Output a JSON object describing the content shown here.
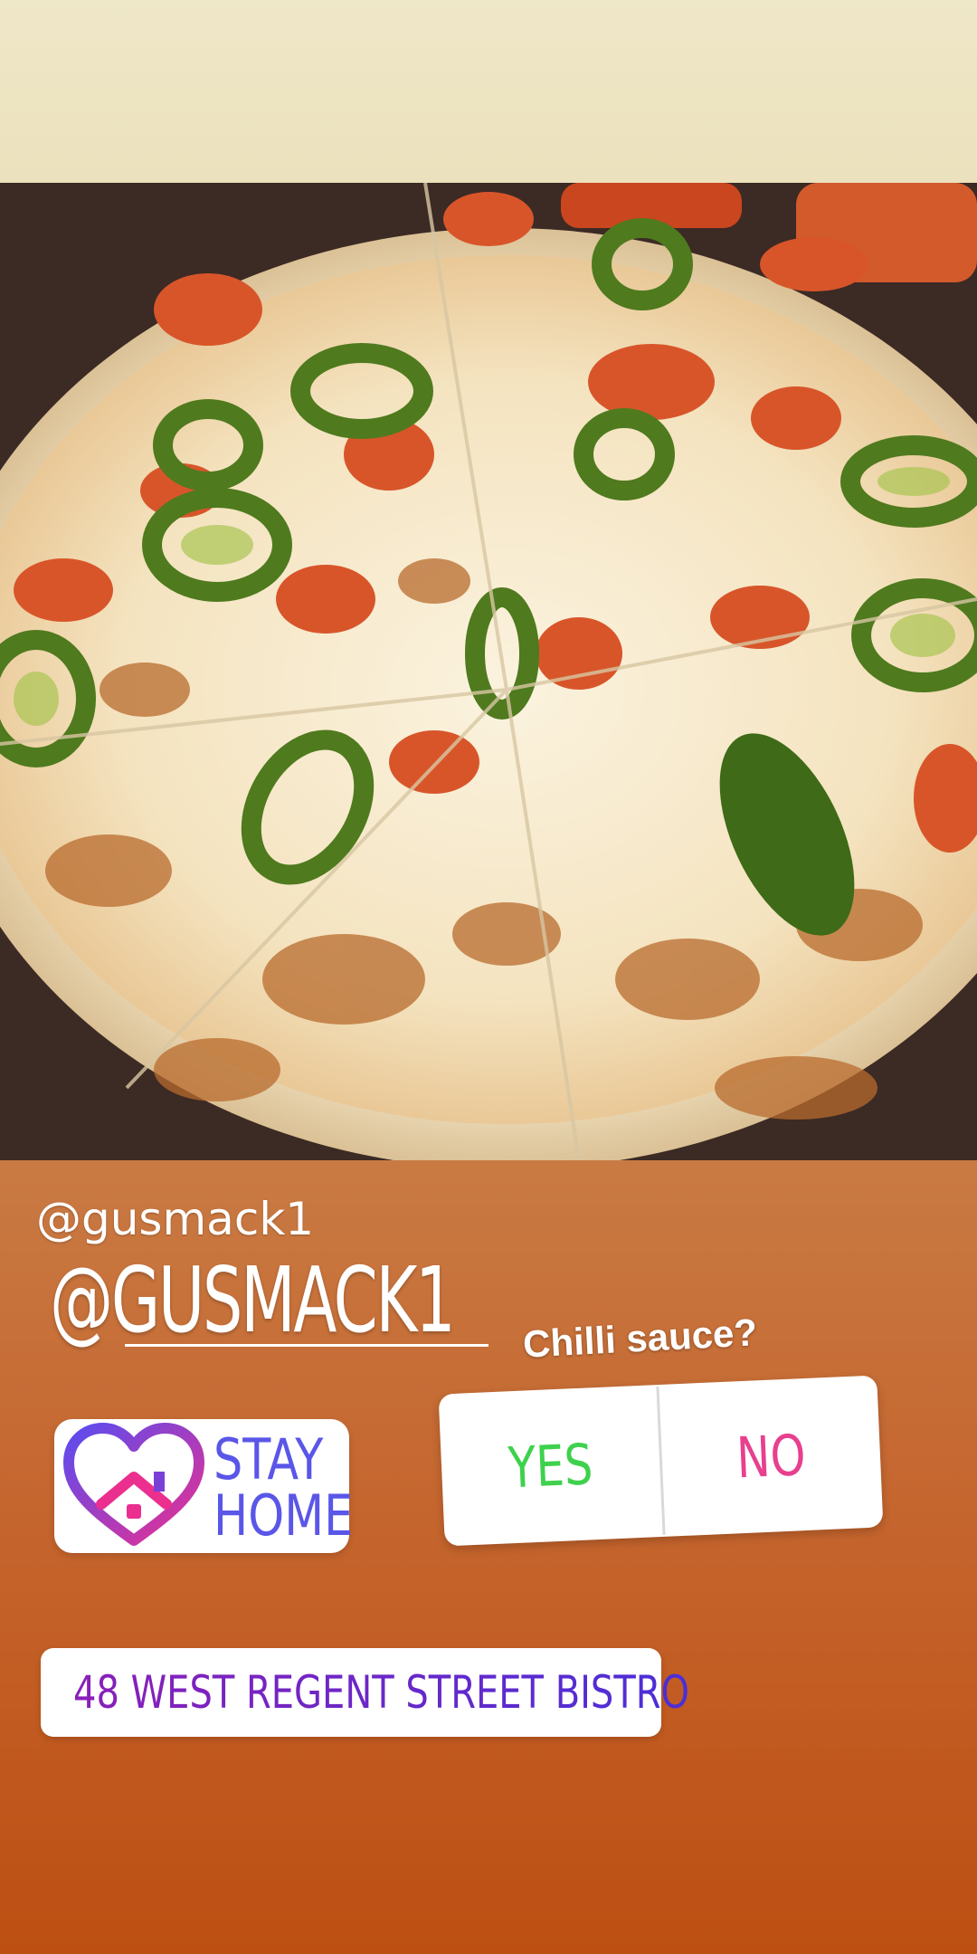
{
  "story": {
    "username": "@gusmack1",
    "mention": "@GUSMACK1"
  },
  "poll": {
    "question": "Chilli sauce?",
    "option_yes": "YES",
    "option_no": "NO",
    "yes_color": "#3fd14d",
    "no_color": "#e83f8e"
  },
  "stay_home_sticker": {
    "line1": "STAY",
    "line2": "HOME",
    "icon": "heart-house-icon"
  },
  "location_sticker": {
    "label": "48 WEST REGENT STREET BISTRO",
    "icon": "location-pin-icon"
  },
  "colors": {
    "background_top": "#ece1bd",
    "background_bottom": "#bd4f12",
    "sticker_text": "#5a56e8"
  }
}
